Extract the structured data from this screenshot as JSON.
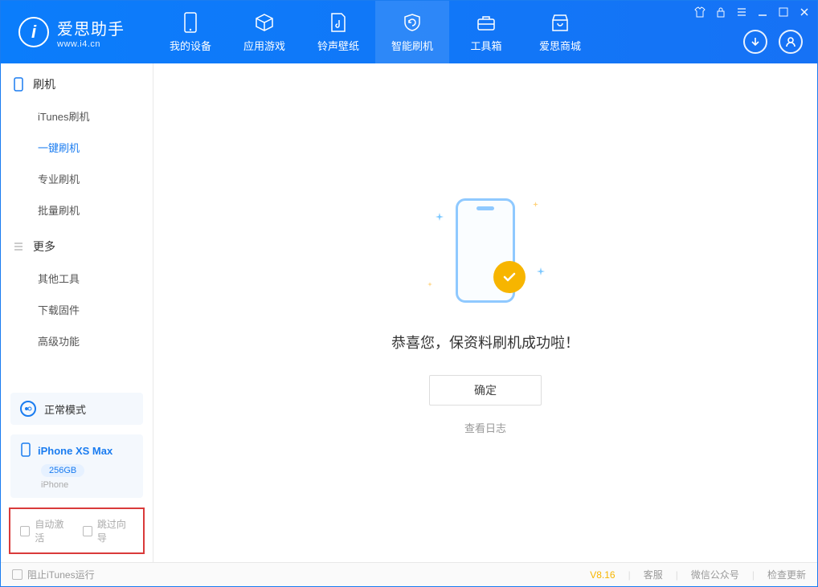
{
  "app": {
    "name_cn": "爱思助手",
    "url": "www.i4.cn"
  },
  "tabs": [
    {
      "label": "我的设备"
    },
    {
      "label": "应用游戏"
    },
    {
      "label": "铃声壁纸"
    },
    {
      "label": "智能刷机",
      "active": true
    },
    {
      "label": "工具箱"
    },
    {
      "label": "爱思商城"
    }
  ],
  "sidebar": {
    "group1_title": "刷机",
    "group1_items": [
      {
        "label": "iTunes刷机"
      },
      {
        "label": "一键刷机",
        "active": true
      },
      {
        "label": "专业刷机"
      },
      {
        "label": "批量刷机"
      }
    ],
    "group2_title": "更多",
    "group2_items": [
      {
        "label": "其他工具"
      },
      {
        "label": "下载固件"
      },
      {
        "label": "高级功能"
      }
    ],
    "mode_card": "正常模式",
    "device": {
      "name": "iPhone XS Max",
      "storage": "256GB",
      "type": "iPhone"
    },
    "check_auto_activate": "自动激活",
    "check_skip_guide": "跳过向导"
  },
  "main": {
    "success_msg": "恭喜您，保资料刷机成功啦！",
    "ok_btn": "确定",
    "view_log": "查看日志"
  },
  "footer": {
    "block_itunes": "阻止iTunes运行",
    "version": "V8.16",
    "support": "客服",
    "wechat": "微信公众号",
    "check_update": "检查更新"
  }
}
